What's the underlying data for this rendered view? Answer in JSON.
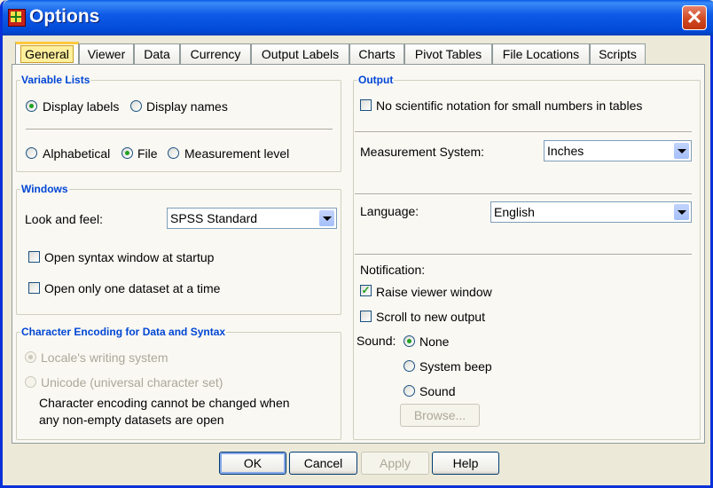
{
  "window": {
    "title": "Options"
  },
  "tabs": [
    "General",
    "Viewer",
    "Data",
    "Currency",
    "Output Labels",
    "Charts",
    "Pivot Tables",
    "File Locations",
    "Scripts"
  ],
  "variable_lists": {
    "title": "Variable Lists",
    "display_labels": "Display labels",
    "display_names": "Display names",
    "alphabetical": "Alphabetical",
    "file": "File",
    "measurement_level": "Measurement level"
  },
  "windows": {
    "title": "Windows",
    "look_and_feel_label": "Look and feel:",
    "look_and_feel_value": "SPSS Standard",
    "open_syntax": "Open syntax window at startup",
    "open_one_dataset": "Open only one dataset at a time"
  },
  "encoding": {
    "title": "Character Encoding for Data and Syntax",
    "locale": "Locale's writing system",
    "unicode": "Unicode (universal character set)",
    "note_line1": "Character encoding cannot be changed when",
    "note_line2": "any non-empty datasets are open"
  },
  "output": {
    "title": "Output",
    "no_sci_notation": "No scientific notation for small numbers in tables",
    "measurement_label": "Measurement System:",
    "measurement_value": "Inches",
    "language_label": "Language:",
    "language_value": "English",
    "notification_label": "Notification:",
    "raise_viewer": "Raise viewer window",
    "scroll_new": "Scroll to new output",
    "sound_label": "Sound:",
    "sound_none": "None",
    "sound_system": "System beep",
    "sound_sound": "Sound",
    "browse": "Browse..."
  },
  "buttons": {
    "ok": "OK",
    "cancel": "Cancel",
    "apply": "Apply",
    "help": "Help"
  }
}
